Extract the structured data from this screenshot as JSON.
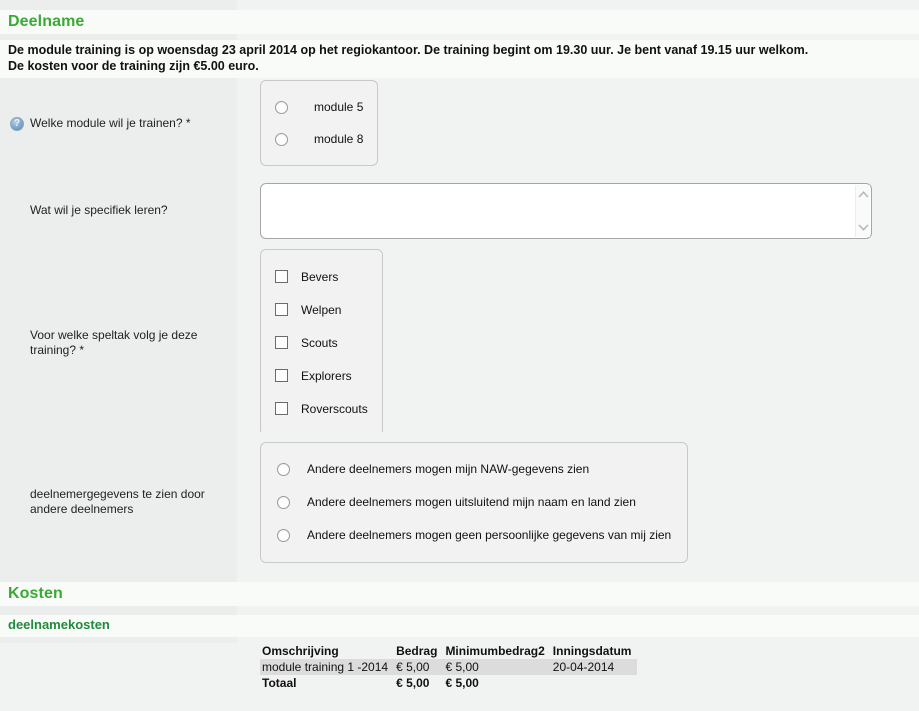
{
  "sections": {
    "deelname": {
      "title": "Deelname",
      "intro_line1": "De module training is op woensdag 23 april 2014 op het regiokantoor. De training begint om 19.30 uur. Je bent vanaf 19.15 uur welkom.",
      "intro_line2": "De kosten voor de training zijn €5.00 euro."
    },
    "kosten": {
      "title": "Kosten",
      "subtitle": "deelnamekosten"
    }
  },
  "fields": {
    "module": {
      "label": "Welke module wil je trainen? *",
      "help_icon": "help-icon",
      "options": [
        {
          "label": "module 5",
          "checked": false
        },
        {
          "label": "module 8",
          "checked": false
        }
      ]
    },
    "specifiek": {
      "label": "Wat wil je specifiek leren?",
      "value": "",
      "placeholder": ""
    },
    "speltak": {
      "label": "Voor welke speltak volg je deze training? *",
      "options": [
        {
          "label": "Bevers",
          "checked": false
        },
        {
          "label": "Welpen",
          "checked": false
        },
        {
          "label": "Scouts",
          "checked": false
        },
        {
          "label": "Explorers",
          "checked": false
        },
        {
          "label": "Roverscouts",
          "checked": false
        }
      ]
    },
    "privacy": {
      "label": "deelnemergegevens te zien door andere deelnemers",
      "options": [
        {
          "label": "Andere deelnemers mogen mijn NAW-gegevens zien",
          "checked": false
        },
        {
          "label": "Andere deelnemers mogen uitsluitend mijn naam en land zien",
          "checked": false
        },
        {
          "label": "Andere deelnemers mogen geen persoonlijke gegevens van mij zien",
          "checked": false
        }
      ]
    }
  },
  "kosten_table": {
    "headers": [
      "Omschrijving",
      "Bedrag",
      "Minimumbedrag2",
      "Inningsdatum"
    ],
    "rows": [
      {
        "omschrijving": "module training 1 -2014",
        "bedrag": "€ 5,00",
        "minimumbedrag2": "€ 5,00",
        "inningsdatum": "20-04-2014"
      }
    ],
    "total": {
      "omschrijving": "Totaal",
      "bedrag": "€ 5,00",
      "minimumbedrag2": "€ 5,00",
      "inningsdatum": ""
    }
  },
  "colors": {
    "heading_green": "#3aaa35",
    "sub_heading_green": "#1e8c3a",
    "label_col_bg": "#eceded",
    "page_bg": "#f1f2f2",
    "band_white": "#f9fbf9",
    "table_row_bg": "#dcdcdc"
  }
}
